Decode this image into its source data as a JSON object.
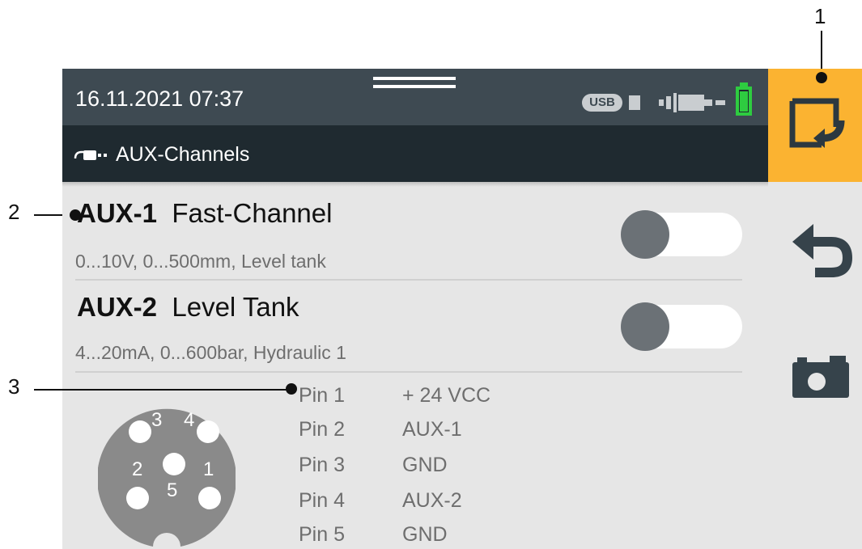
{
  "callouts": {
    "c1": "1",
    "c2": "2",
    "c3": "3"
  },
  "status": {
    "datetime": "16.11.2021 07:37",
    "usb_label": "USB"
  },
  "title": {
    "text": "AUX-Channels",
    "icon": "sensor-cable-icon"
  },
  "channels": [
    {
      "id": "AUX-1",
      "name": "Fast-Channel",
      "desc": "0...10V, 0...500mm, Level tank",
      "enabled": false
    },
    {
      "id": "AUX-2",
      "name": "Level Tank",
      "desc": "4...20mA, 0...600bar, Hydraulic 1",
      "enabled": false
    }
  ],
  "pins": [
    {
      "pin": "Pin 1",
      "signal": "+ 24 VCC"
    },
    {
      "pin": "Pin 2",
      "signal": "AUX-1"
    },
    {
      "pin": "Pin 3",
      "signal": "GND"
    },
    {
      "pin": "Pin 4",
      "signal": "AUX-2"
    },
    {
      "pin": "Pin 5",
      "signal": "GND"
    }
  ],
  "connector": {
    "n1": "1",
    "n2": "2",
    "n3": "3",
    "n4": "4",
    "n5": "5"
  },
  "sidebar": {
    "export_icon": "export-icon",
    "back_icon": "back-arrow-icon",
    "screenshot_icon": "camera-icon"
  },
  "colors": {
    "statusbar": "#3e4a52",
    "titlebar": "#1f2a30",
    "accent": "#fbb331",
    "background": "#e6e6e6",
    "battery": "#2ecc40"
  }
}
